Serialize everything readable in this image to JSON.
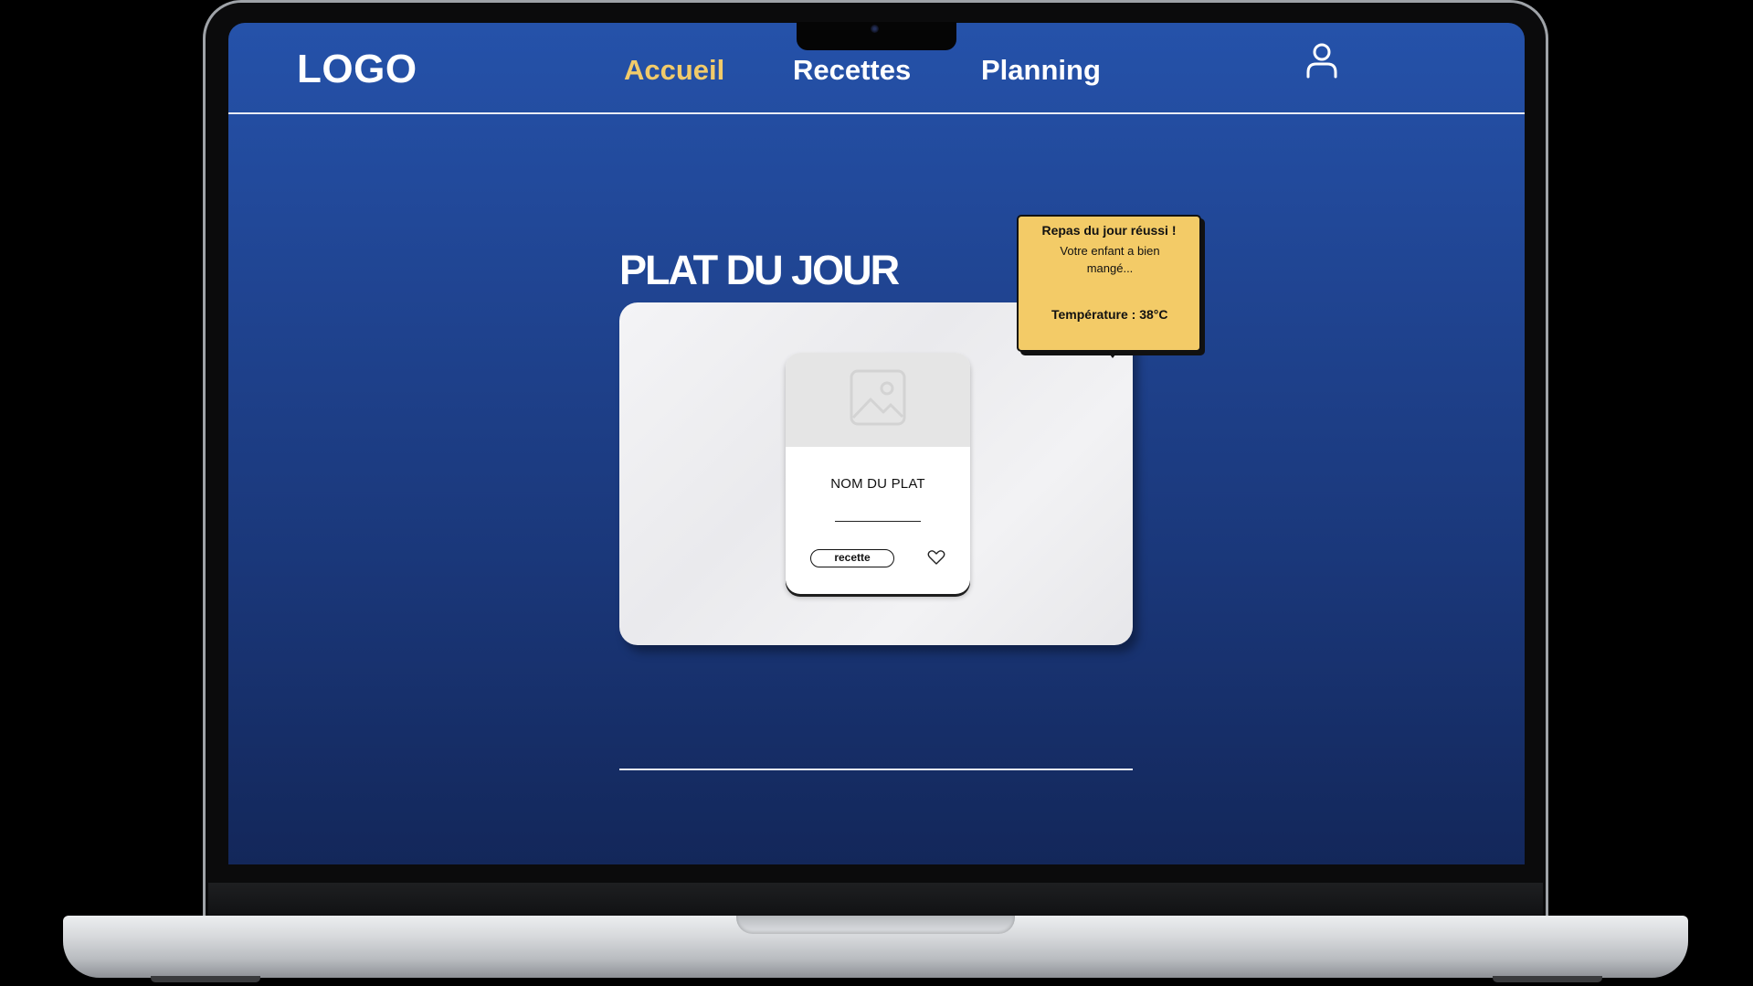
{
  "nav": {
    "logo": "LOGO",
    "items": [
      {
        "label": "Accueil",
        "active": true
      },
      {
        "label": "Recettes",
        "active": false
      },
      {
        "label": "Planning",
        "active": false
      }
    ],
    "user_icon": "user-icon"
  },
  "main": {
    "section_title": "PLAT DU JOUR",
    "dish_card": {
      "image_icon": "image-placeholder-icon",
      "name": "NOM DU PLAT",
      "recipe_button": "recette",
      "favorite_icon": "heart-icon"
    },
    "notification": {
      "title": "Repas du jour réussi !",
      "body": "Votre enfant a bien mangé...",
      "temperature": "Température : 38°C"
    }
  },
  "colors": {
    "background_top": "#2552aa",
    "background_bottom": "#13275a",
    "accent_active": "#f1cb6a",
    "notification_bg": "#f3cb67",
    "panel_bg": "#efeff1"
  }
}
